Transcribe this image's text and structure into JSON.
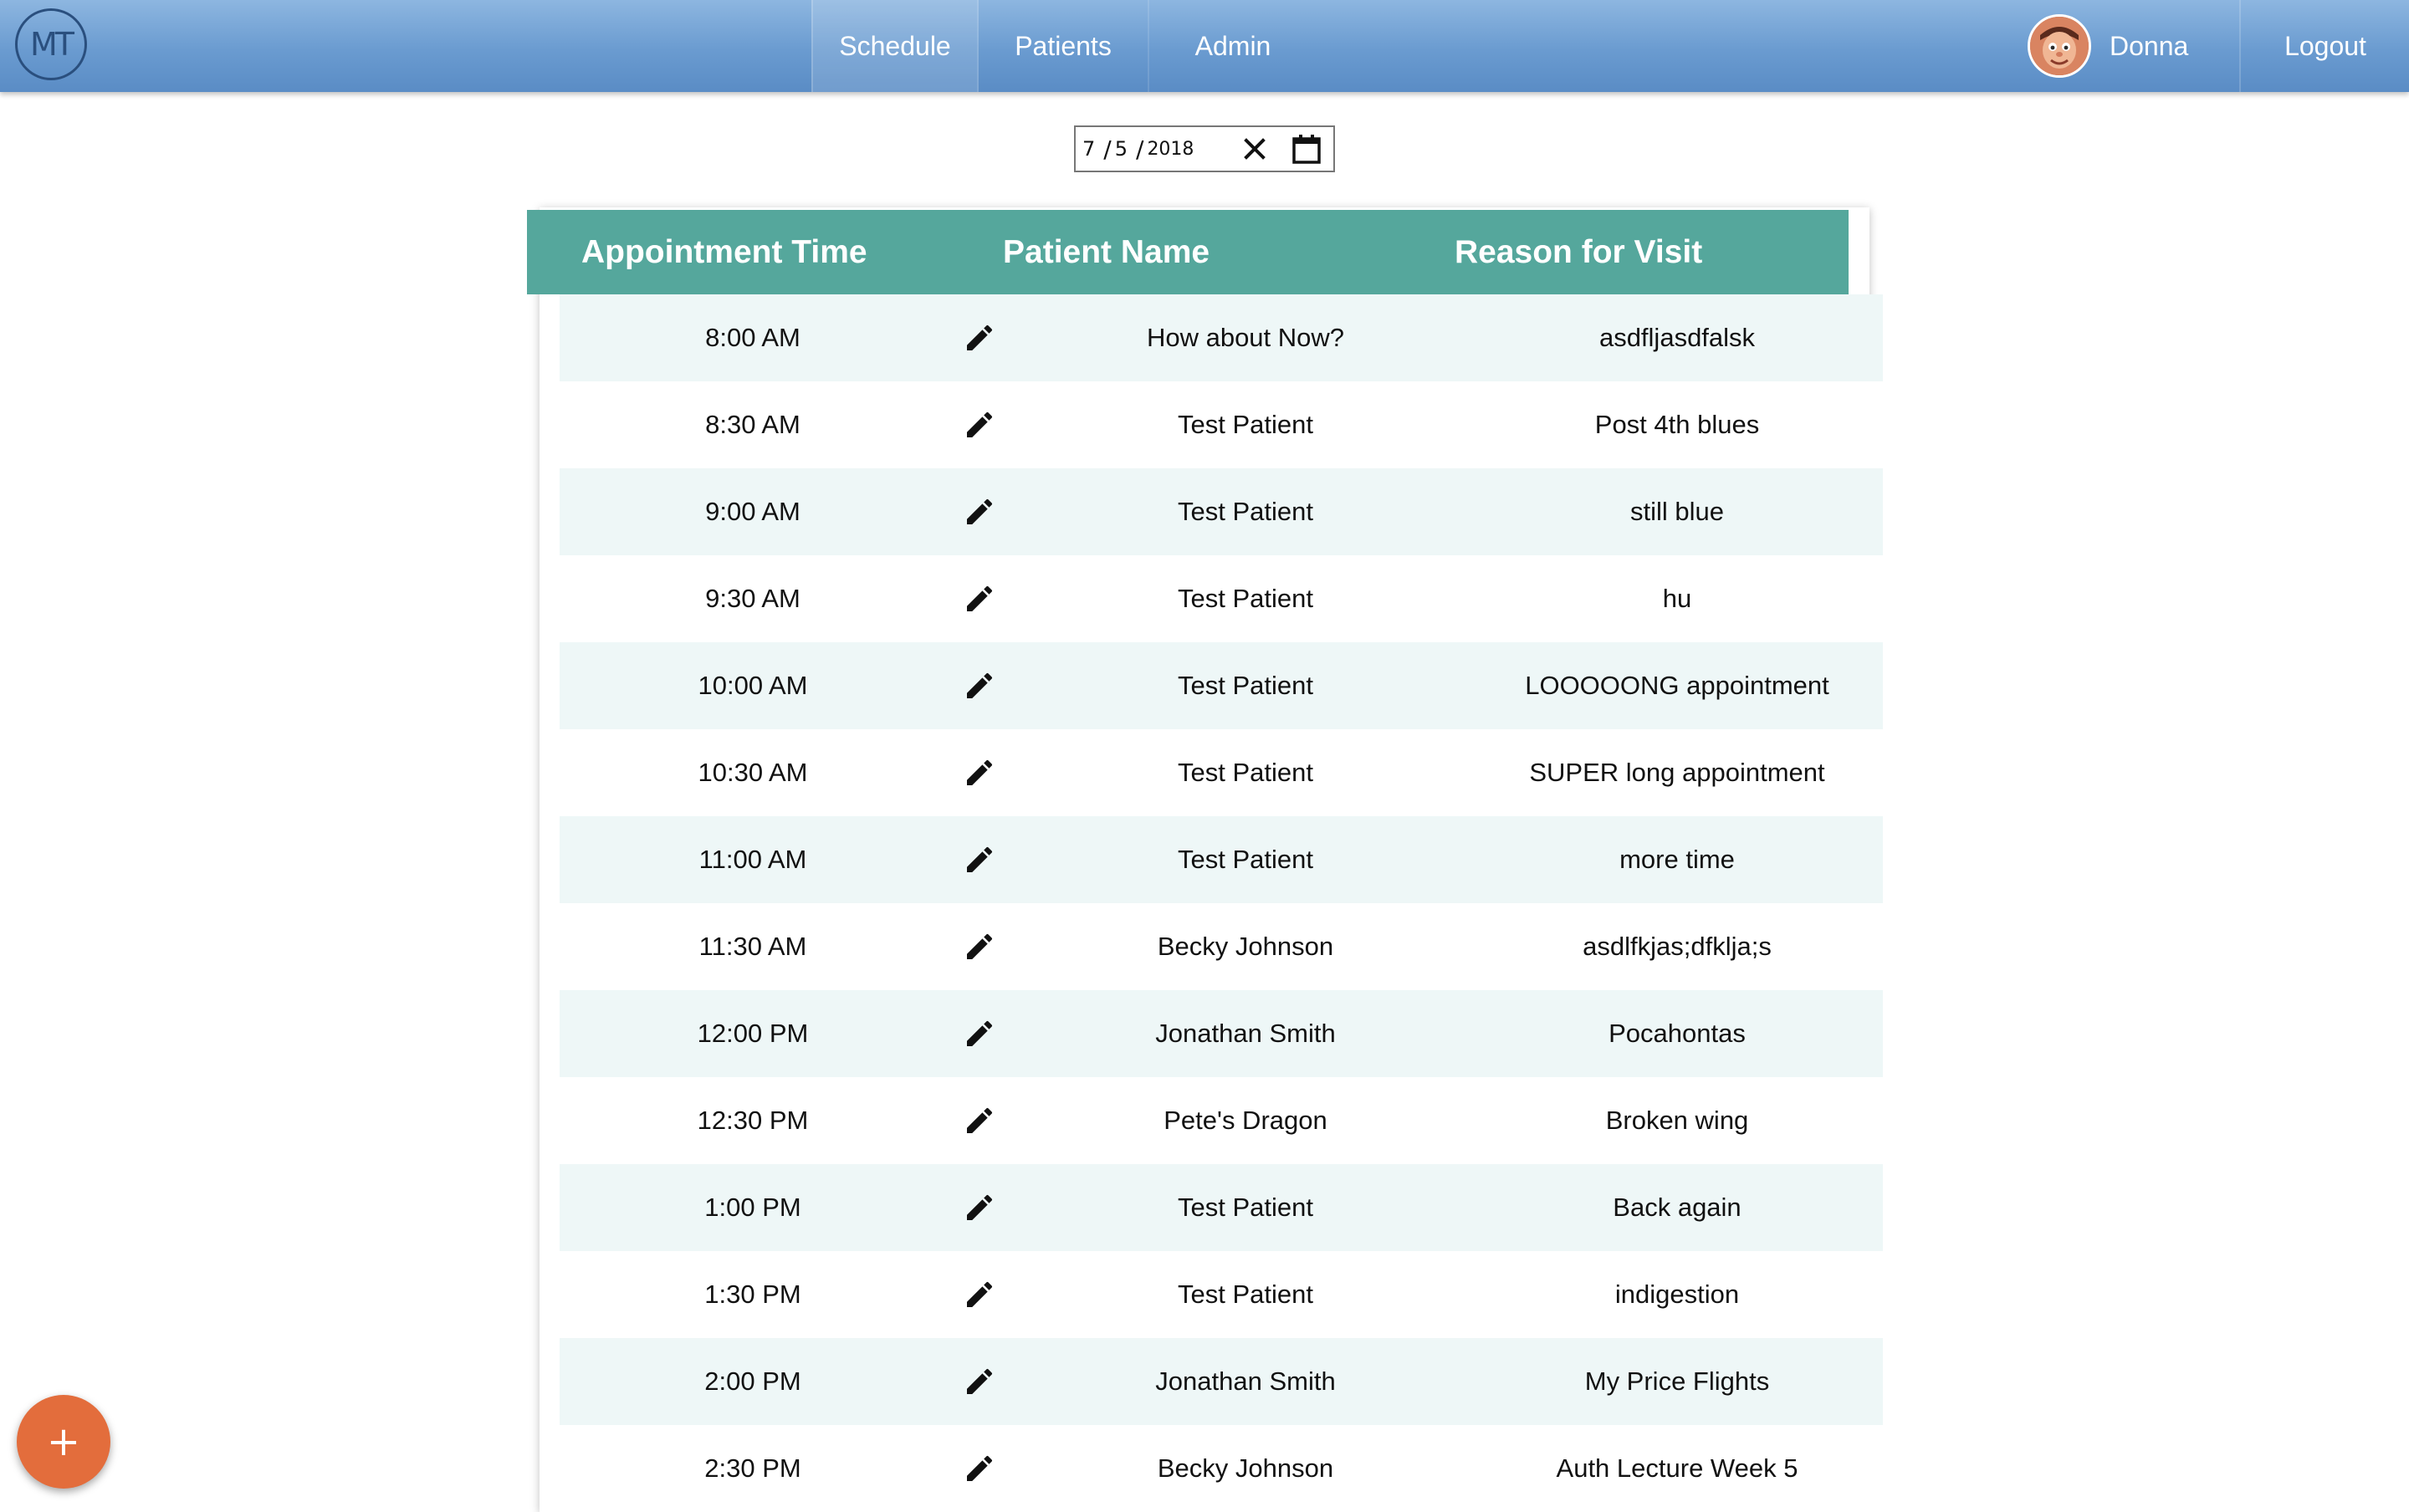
{
  "app": {
    "logo_text": "MT"
  },
  "nav": {
    "tabs": [
      {
        "label": "Schedule",
        "active": true
      },
      {
        "label": "Patients",
        "active": false
      },
      {
        "label": "Admin",
        "active": false
      }
    ],
    "user_name": "Donna",
    "logout_label": "Logout"
  },
  "date_picker": {
    "month": "7",
    "day": "5",
    "year": "2018",
    "clear_icon": "close-icon",
    "calendar_icon": "calendar-icon"
  },
  "table": {
    "headers": [
      "Appointment Time",
      "Patient Name",
      "Reason for Visit"
    ],
    "rows": [
      {
        "time": "8:00 AM",
        "name": "How about Now?",
        "reason": "asdfljasdfalsk"
      },
      {
        "time": "8:30 AM",
        "name": "Test Patient",
        "reason": "Post 4th blues"
      },
      {
        "time": "9:00 AM",
        "name": "Test Patient",
        "reason": "still blue"
      },
      {
        "time": "9:30 AM",
        "name": "Test Patient",
        "reason": "hu"
      },
      {
        "time": "10:00 AM",
        "name": "Test Patient",
        "reason": "LOOOOONG appointment"
      },
      {
        "time": "10:30 AM",
        "name": "Test Patient",
        "reason": "SUPER long appointment"
      },
      {
        "time": "11:00 AM",
        "name": "Test Patient",
        "reason": "more time"
      },
      {
        "time": "11:30 AM",
        "name": "Becky Johnson",
        "reason": "asdlfkjas;dfklja;s"
      },
      {
        "time": "12:00 PM",
        "name": "Jonathan Smith",
        "reason": "Pocahontas"
      },
      {
        "time": "12:30 PM",
        "name": "Pete's Dragon",
        "reason": "Broken wing"
      },
      {
        "time": "1:00 PM",
        "name": "Test Patient",
        "reason": "Back again"
      },
      {
        "time": "1:30 PM",
        "name": "Test Patient",
        "reason": "indigestion"
      },
      {
        "time": "2:00 PM",
        "name": "Jonathan Smith",
        "reason": "My Price Flights"
      },
      {
        "time": "2:30 PM",
        "name": "Becky Johnson",
        "reason": "Auth Lecture Week 5"
      }
    ]
  },
  "fab": {
    "label": "+",
    "icon": "plus-icon"
  },
  "colors": {
    "nav_top": "#8db6e0",
    "nav_bottom": "#5a8cc5",
    "table_header": "#55a79c",
    "row_alt": "#eef7f7",
    "fab": "#e36d3c"
  }
}
